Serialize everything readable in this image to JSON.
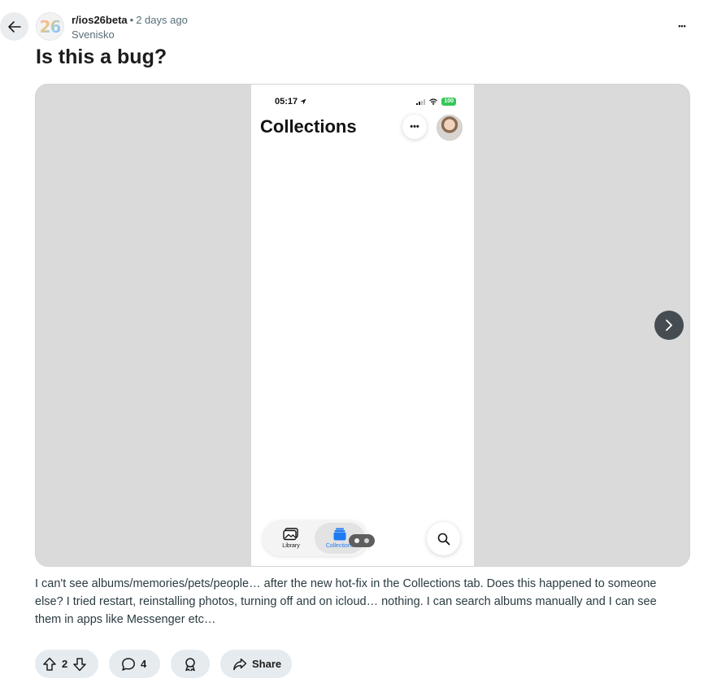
{
  "post": {
    "subreddit": "r/ios26beta",
    "subreddit_icon_text": "26",
    "separator": "•",
    "age": "2 days ago",
    "author": "Svenisko",
    "title": "Is this a bug?",
    "body": "I can't see albums/memories/pets/people… after the new hot-fix in the Collections tab. Does this happened to someone else? I tried restart, reinstalling photos, turning off and on icloud… nothing. I can search albums manually and I can see them in apps like Messenger etc…",
    "more_label": "•••"
  },
  "image": {
    "time": "05:17",
    "battery": "100",
    "title": "Collections",
    "more_label": "•••",
    "tabs": [
      {
        "label": "Library"
      },
      {
        "label": "Collections"
      }
    ]
  },
  "actions": {
    "upvotes": "2",
    "comments": "4",
    "share_label": "Share"
  },
  "colors": {
    "pill_bg": "#e5ebee",
    "media_bg": "#dadada",
    "accent_blue": "#1f7bf2",
    "battery_green": "#34c759",
    "meta_gray": "#576f76"
  }
}
